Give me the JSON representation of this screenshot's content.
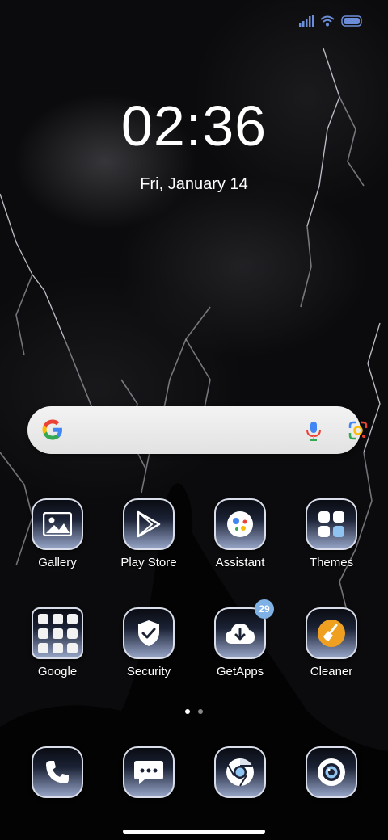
{
  "status_bar": {
    "icons": [
      "signal-icon",
      "wifi-icon",
      "battery-icon"
    ]
  },
  "lockscreen": {
    "time": "02:36",
    "date": "Fri, January 14"
  },
  "search": {
    "icons": [
      "google-g-icon",
      "microphone-icon",
      "google-lens-icon"
    ]
  },
  "apps": [
    {
      "label": "Gallery",
      "icon": "gallery-icon"
    },
    {
      "label": "Play Store",
      "icon": "play-store-icon"
    },
    {
      "label": "Assistant",
      "icon": "assistant-icon"
    },
    {
      "label": "Themes",
      "icon": "themes-icon"
    },
    {
      "label": "Google",
      "icon": "folder-icon"
    },
    {
      "label": "Security",
      "icon": "shield-check-icon"
    },
    {
      "label": "GetApps",
      "icon": "cloud-download-icon",
      "badge": "29"
    },
    {
      "label": "Cleaner",
      "icon": "broom-icon"
    }
  ],
  "dock": [
    {
      "icon": "phone-icon"
    },
    {
      "icon": "messages-icon"
    },
    {
      "icon": "chrome-icon"
    },
    {
      "icon": "camera-icon"
    }
  ],
  "page_indicator": {
    "pages": 2,
    "current": 1
  },
  "colors": {
    "badge": "#7fb1e4",
    "cleaner_accent": "#f0a020"
  }
}
